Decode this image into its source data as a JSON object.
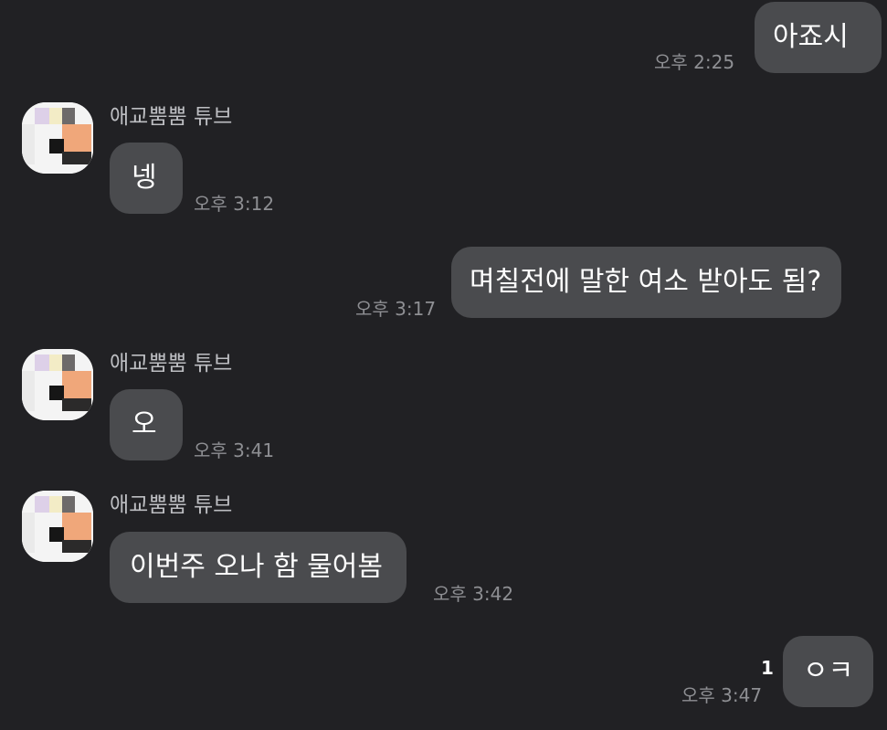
{
  "messages": [
    {
      "text": "아죠시",
      "time": "오후 2:25"
    },
    {
      "sender": "애교뿜뿜 튜브",
      "text": "넹",
      "time": "오후 3:12"
    },
    {
      "text": "며칠전에 말한 여소 받아도 됨?",
      "time": "오후 3:17"
    },
    {
      "sender": "애교뿜뿜 튜브",
      "text": "오",
      "time": "오후 3:41"
    },
    {
      "sender": "애교뿜뿜 튜브",
      "text": "이번주 오나 함 물어봄",
      "time": "오후 3:42"
    },
    {
      "text": "ㅇㅋ",
      "time": "오후 3:47",
      "unread": "1"
    }
  ],
  "colors": {
    "background": "#212124",
    "bubble": "#4a4b4e",
    "timestamp": "#8e8f93",
    "sender": "#bdbec2"
  },
  "icons": {
    "avatar": "pixelated-profile-icon"
  }
}
